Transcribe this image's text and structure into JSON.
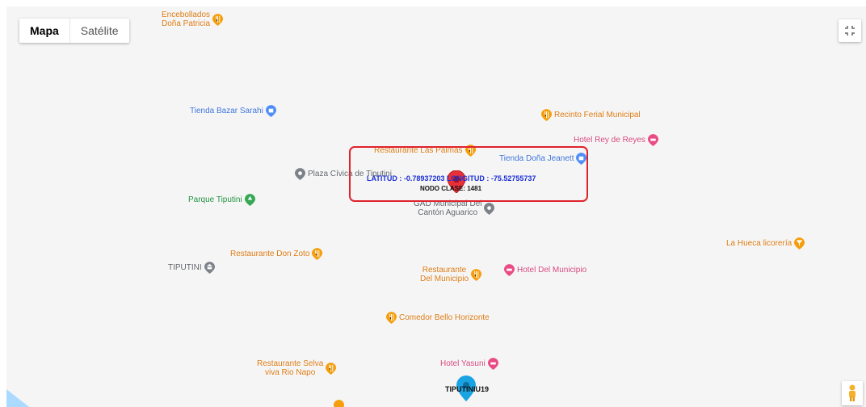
{
  "map_type": {
    "options": [
      "Mapa",
      "Satélite"
    ],
    "active": "Mapa"
  },
  "colors": {
    "poi_orange": "#f59e0b",
    "poi_blue": "#4f8ef7",
    "poi_pink": "#e94c84",
    "poi_green": "#34a853",
    "poi_gray": "#7c8288",
    "highlight": "#e0212b",
    "coord_text": "#1a2fd6",
    "marker_red": "#e8303a",
    "marker_blue": "#1aa3e3"
  },
  "pois": {
    "encebollados": [
      "Encebollados",
      "Doña Patricia"
    ],
    "tienda_sarahi": "Tienda Bazar Sarahi",
    "recinto": "Recinto Ferial Municipal",
    "rey_reyes": "Hotel Rey de Reyes",
    "las_palmas": "Restaurante Las Palmas",
    "dona_jeanett": "Tienda Doña Jeanett",
    "plaza": "Plaza Cívica de Tiputini",
    "parque": "Parque Tiputini",
    "gad": [
      "GAD Municipal Del",
      "Cantón Aguarico"
    ],
    "la_hueca": "La Hueca licorería",
    "don_zoto": "Restaurante Don Zoto",
    "tiputini_town": "TIPUTINI",
    "rest_municipio": [
      "Restaurante",
      "Del Municipio"
    ],
    "hotel_municipio": "Hotel Del Municipio",
    "comedor": "Comedor Bello Horizonte",
    "hotel_yasuni": "Hotel Yasuni",
    "selva": [
      "Restaurante Selva",
      "viva Rio Napo"
    ]
  },
  "markers": {
    "selected": {
      "latitud": "LATITUD : -0.78937203",
      "longitud": "LONGITUD : -75.52755737",
      "nodo": "NODO CLASE: 1481"
    },
    "secondary": {
      "label": "TIPUTINIU19"
    }
  }
}
